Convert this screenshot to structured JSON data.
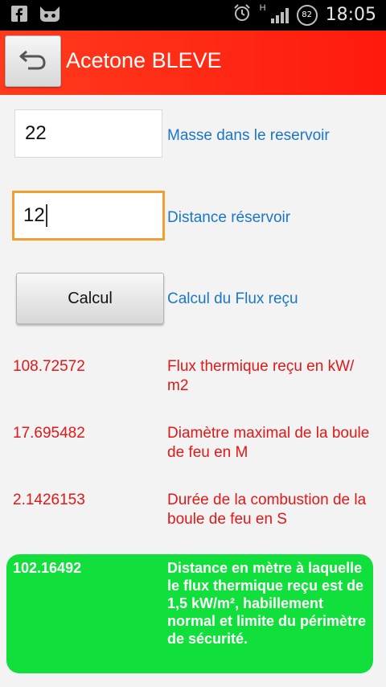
{
  "status_bar": {
    "time": "18:05",
    "battery": "82",
    "network_type": "H",
    "icons": [
      "facebook-icon",
      "cat-icon",
      "alarm-icon",
      "signal-icon",
      "battery-icon"
    ]
  },
  "action_bar": {
    "title": "Acetone BLEVE",
    "back_icon": "back-arrow-icon",
    "color": "#ff2a14"
  },
  "inputs": {
    "masse": {
      "value": "22",
      "label": "Masse dans le reservoir"
    },
    "distance": {
      "value": "12",
      "label": "Distance réservoir"
    }
  },
  "calc": {
    "button_label": "Calcul",
    "label": "Calcul du Flux reçu"
  },
  "results": [
    {
      "value": "108.72572",
      "label": "Flux thermique reçu en kW/ m2"
    },
    {
      "value": "17.695482",
      "label": "Diamètre maximal de la boule de feu en M"
    },
    {
      "value": "2.1426153",
      "label": "Durée de la combustion de la boule de feu en S"
    }
  ],
  "safety": {
    "value": "102.16492",
    "label": "Distance en mètre à laquelle le flux thermique reçu est de 1,5 kW/m², habillement normal et limite du périmètre de sécurité.",
    "color": "#11e03c"
  }
}
